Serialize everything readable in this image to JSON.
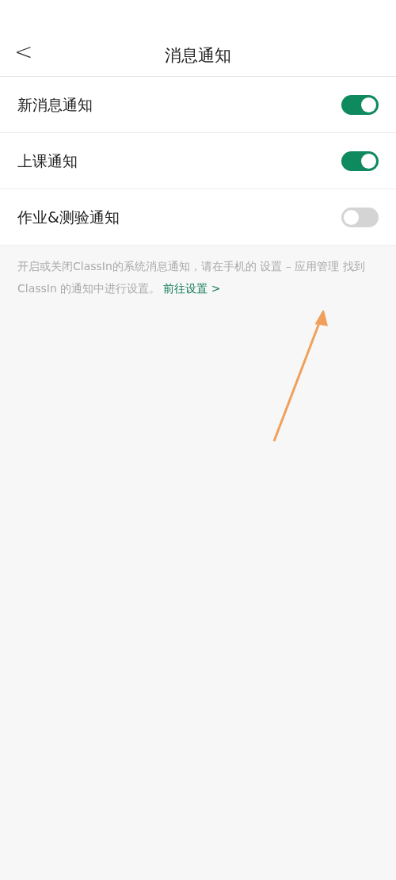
{
  "header": {
    "back": "<",
    "title": "消息通知"
  },
  "settings": [
    {
      "label": "新消息通知",
      "on": true
    },
    {
      "label": "上课通知",
      "on": true
    },
    {
      "label": "作业&测验通知",
      "on": false
    }
  ],
  "description": {
    "text": "开启或关闭ClassIn的系统消息通知，请在手机的 设置 – 应用管理 找到 ClassIn 的通知中进行设置。",
    "link": "前往设置 >"
  }
}
